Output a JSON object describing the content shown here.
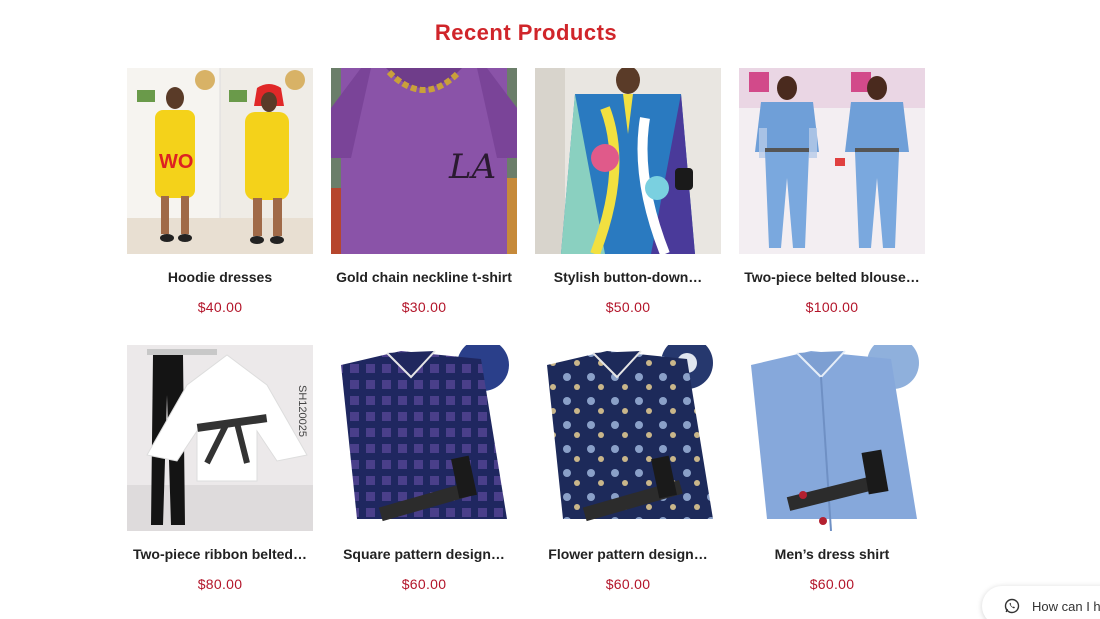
{
  "section": {
    "title": "Recent Products"
  },
  "products": [
    {
      "name": "Hoodie dresses",
      "price": "$40.00",
      "image": "hoodie-dress-photo"
    },
    {
      "name": "Gold chain neckline t-shirt",
      "price": "$30.00",
      "image": "purple-tshirt-photo"
    },
    {
      "name": "Stylish button-down…",
      "price": "$50.00",
      "image": "printed-kaftan-photo"
    },
    {
      "name": "Two-piece belted blouse…",
      "price": "$100.00",
      "image": "blue-two-piece-photo"
    },
    {
      "name": "Two-piece ribbon belted…",
      "price": "$80.00",
      "image": "white-blouse-black-pants-photo"
    },
    {
      "name": "Square pattern design…",
      "price": "$60.00",
      "image": "navy-square-shirt-photo"
    },
    {
      "name": "Flower pattern design…",
      "price": "$60.00",
      "image": "navy-flower-shirt-photo"
    },
    {
      "name": "Men’s dress shirt",
      "price": "$60.00",
      "image": "light-blue-shirt-photo"
    }
  ],
  "chat": {
    "label": "How can I h",
    "icon": "whatsapp-icon"
  },
  "colors": {
    "accent": "#d0252a",
    "price": "#b3152a"
  }
}
